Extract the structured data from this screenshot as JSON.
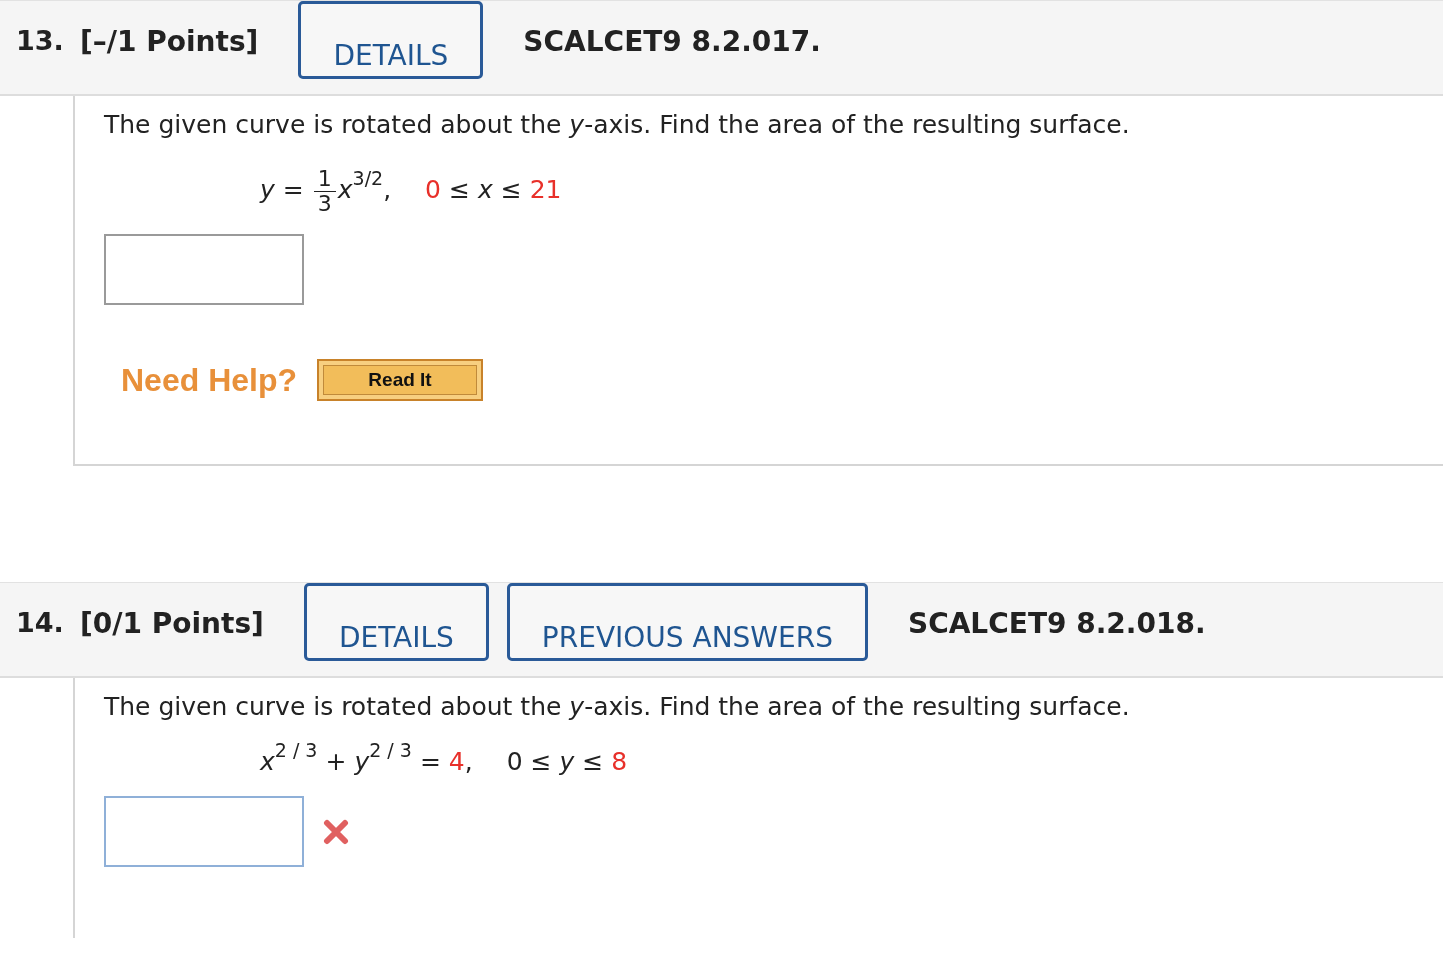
{
  "questions": [
    {
      "number": "13.",
      "points": "[–/1 Points]",
      "buttons": [
        "DETAILS"
      ],
      "code": "SCALCET9 8.2.017.",
      "prompt": "The given curve is rotated about the *y*-axis. Find the area of the resulting surface.",
      "formula": [
        {
          "kind": "var",
          "text": "y"
        },
        {
          "kind": "op",
          "text": "="
        },
        {
          "kind": "frac",
          "numerator": "1",
          "denominator": "3"
        },
        {
          "kind": "var",
          "text": "x"
        },
        {
          "kind": "sup",
          "text": "3/2"
        },
        {
          "kind": "punct",
          "text": ","
        },
        {
          "kind": "gap"
        },
        {
          "kind": "param",
          "text": "0"
        },
        {
          "kind": "op",
          "text": "≤"
        },
        {
          "kind": "var",
          "text": "x"
        },
        {
          "kind": "op",
          "text": "≤"
        },
        {
          "kind": "param",
          "text": "21"
        }
      ],
      "answer": {
        "marked_wrong": false
      },
      "help": {
        "label": "Need Help?",
        "buttons": [
          "Read It"
        ]
      }
    },
    {
      "number": "14.",
      "points": "[0/1 Points]",
      "buttons": [
        "DETAILS",
        "PREVIOUS ANSWERS"
      ],
      "code": "SCALCET9 8.2.018.",
      "prompt": "The given curve is rotated about the *y*-axis. Find the area of the resulting surface.",
      "formula": [
        {
          "kind": "var",
          "text": "x"
        },
        {
          "kind": "sup",
          "text": "2 / 3"
        },
        {
          "kind": "op",
          "text": "+"
        },
        {
          "kind": "var",
          "text": "y"
        },
        {
          "kind": "sup",
          "text": "2 / 3"
        },
        {
          "kind": "op",
          "text": "="
        },
        {
          "kind": "param",
          "text": "4"
        },
        {
          "kind": "punct",
          "text": ","
        },
        {
          "kind": "gap"
        },
        {
          "kind": "num",
          "text": "0"
        },
        {
          "kind": "op",
          "text": "≤"
        },
        {
          "kind": "var",
          "text": "y"
        },
        {
          "kind": "op",
          "text": "≤"
        },
        {
          "kind": "param",
          "text": "8"
        }
      ],
      "answer": {
        "marked_wrong": true
      }
    }
  ]
}
